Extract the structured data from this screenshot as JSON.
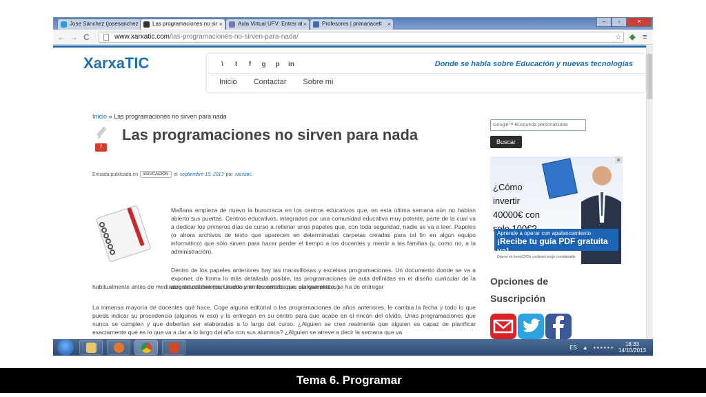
{
  "browser": {
    "tabs": [
      {
        "label": "Jose Sánchez (josesanchez",
        "favicon_color": "#2a9fd6"
      },
      {
        "label": "Las programaciones no sir",
        "favicon_color": "#333333"
      },
      {
        "label": "Aula Virtual UFV: Entrar al",
        "favicon_color": "#7a7aa8"
      },
      {
        "label": "Profesores | primariacelt",
        "favicon_color": "#446aa0"
      }
    ],
    "close_glyph": "×",
    "window_controls": {
      "minimize": "–",
      "maximize": "▫",
      "close": "×"
    },
    "nav": {
      "back": "←",
      "forward": "→",
      "reload": "C"
    },
    "url_domain": "www.xarxatic.com",
    "url_path": "/las-programaciones-no-sirven-para-nada/",
    "star_icon": "☆",
    "menu_icon": "≡"
  },
  "site": {
    "logo": "XarxaTIC",
    "tagline": "Donde se habla sobre Educación y nuevas tecnologías",
    "social_icons": [
      "rss-icon",
      "twitter-icon",
      "facebook-icon",
      "google-plus-icon",
      "pinterest-icon",
      "linkedin-icon"
    ],
    "social_glyphs": [
      "\\",
      "t",
      "f",
      "g",
      "p",
      "in"
    ],
    "menu": [
      "Inicio",
      "Contactar",
      "Sobre mi"
    ]
  },
  "post": {
    "breadcrumb_home": "Inicio",
    "breadcrumb_sep": "»",
    "breadcrumb_current": "Las programaciones no sirven para nada",
    "title": "Las programaciones no sirven para nada",
    "comment_count": "7",
    "meta_prefix": "Entrada publicada en",
    "category": "EDUCACIÓN",
    "meta_el": "el",
    "date": "septiembre 15, 2013",
    "meta_por": "por",
    "author": "xarxatic",
    "meta_end": ".",
    "paragraphs": [
      "Mañana empieza de nuevo la burocracia en los centros educativos que, en esta última semana aún no habían abierto sus puertas. Centros educativos, integrados por una comunidad educativa muy potente, parte de la cual va a dedicar los primeros días de curso a rellenar unos papeles que, con toda seguridad, nadie se va a leer. Papeles (o ahora archivos de texto que aparecen en determinadas carpetas creadas para tal fin en algún equipo informático) que sólo sirven para hacer perder el tiempo a los docentes y mentir a las familias (y, como no, a la administración).",
      "Dentro de los papeles anteriores hay las maravillosas y excelsas programaciones. Un documento donde se va a exponer, de forma lo más detallada posible, las programaciones de aula definidas en el diseño curricular de la asignatura/materia. Un documento cerrado que, curiosamente, se ha de entregar",
      "habitualmente antes de mediados de octubre (con suerte y en los centros que alargan plazos).",
      "La inmensa mayoría de docentes qué hace. Coge alguna editorial o las programaciones de años anteriores, le cambia la fecha y todo lo que pueda indicar su procedencia (algunos ni eso) y la entregan en su centro para que acabe en el rincón del olvido. Unas programaciones que nunca se cumplen y que deberían ser elaboradas a lo largo del curso. ¿Alguien se cree realmente que alguien es capaz de planificar exactamente qué es lo que va a dar a lo largo del año con sus alumnos? ¿Alguien se atreve a decir la semana que va"
    ]
  },
  "sidebar": {
    "search_placeholder": "Google™ Búsqueda personalizada",
    "search_button": "Buscar",
    "ad_headline": "¿Cómo invertir 40000€ con solo 100€?",
    "ad_cta_line1": "Aprende a operar con apalancamiento",
    "ad_cta_line2": "¡Recibe tu guía PDF gratuita ya!",
    "ad_fine_print": "Operar en forex/CFDs conlleva riesgo considerable",
    "ad_close": "×",
    "subscription_title": "Opciones de Suscripción",
    "subscription_colors": [
      "#d8232a",
      "#2aa3e0",
      "#3b5998"
    ]
  },
  "taskbar": {
    "apps": [
      {
        "name": "explorer-app",
        "color": "#e8c66a"
      },
      {
        "name": "firefox-app",
        "color": "#e4772b"
      },
      {
        "name": "chrome-app",
        "color": "#4c9a3e"
      },
      {
        "name": "powerpoint-app",
        "color": "#d24726"
      }
    ],
    "language": "ES",
    "time": "18:33",
    "date": "14/10/2013"
  },
  "caption": "Tema 6. Programar"
}
